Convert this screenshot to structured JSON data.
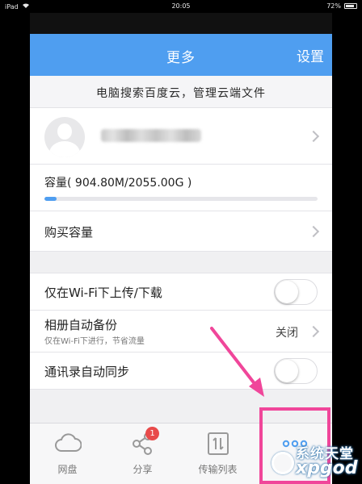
{
  "status_bar": {
    "device": "iPad",
    "time": "20:05",
    "battery": "72%"
  },
  "header": {
    "title": "更多",
    "settings_label": "设置"
  },
  "promo_text": "电脑搜索百度云，管理云端文件",
  "capacity": {
    "label": "容量( 904.80M/2055.00G )",
    "used_fraction": 0.044
  },
  "buy_capacity_label": "购买容量",
  "settings": {
    "wifi_only": {
      "label": "仅在Wi-Fi下上传/下载",
      "on": false
    },
    "album_backup": {
      "label": "相册自动备份",
      "sub": "仅在Wi-Fi下进行，节省流量",
      "value": "关闭"
    },
    "contacts_sync": {
      "label": "通讯录自动同步",
      "on": false
    }
  },
  "tabs": [
    {
      "label": "网盘",
      "icon": "cloud-icon"
    },
    {
      "label": "分享",
      "icon": "share-icon",
      "badge": "1"
    },
    {
      "label": "传输列表",
      "icon": "transfer-icon"
    },
    {
      "label": "",
      "icon": "more-dots-icon"
    }
  ],
  "watermark": {
    "line1": "系统天堂",
    "line2": "xpgod"
  },
  "colors": {
    "accent": "#4f9ef0",
    "annotation": "#f0469a",
    "badge": "#e84a4a"
  }
}
